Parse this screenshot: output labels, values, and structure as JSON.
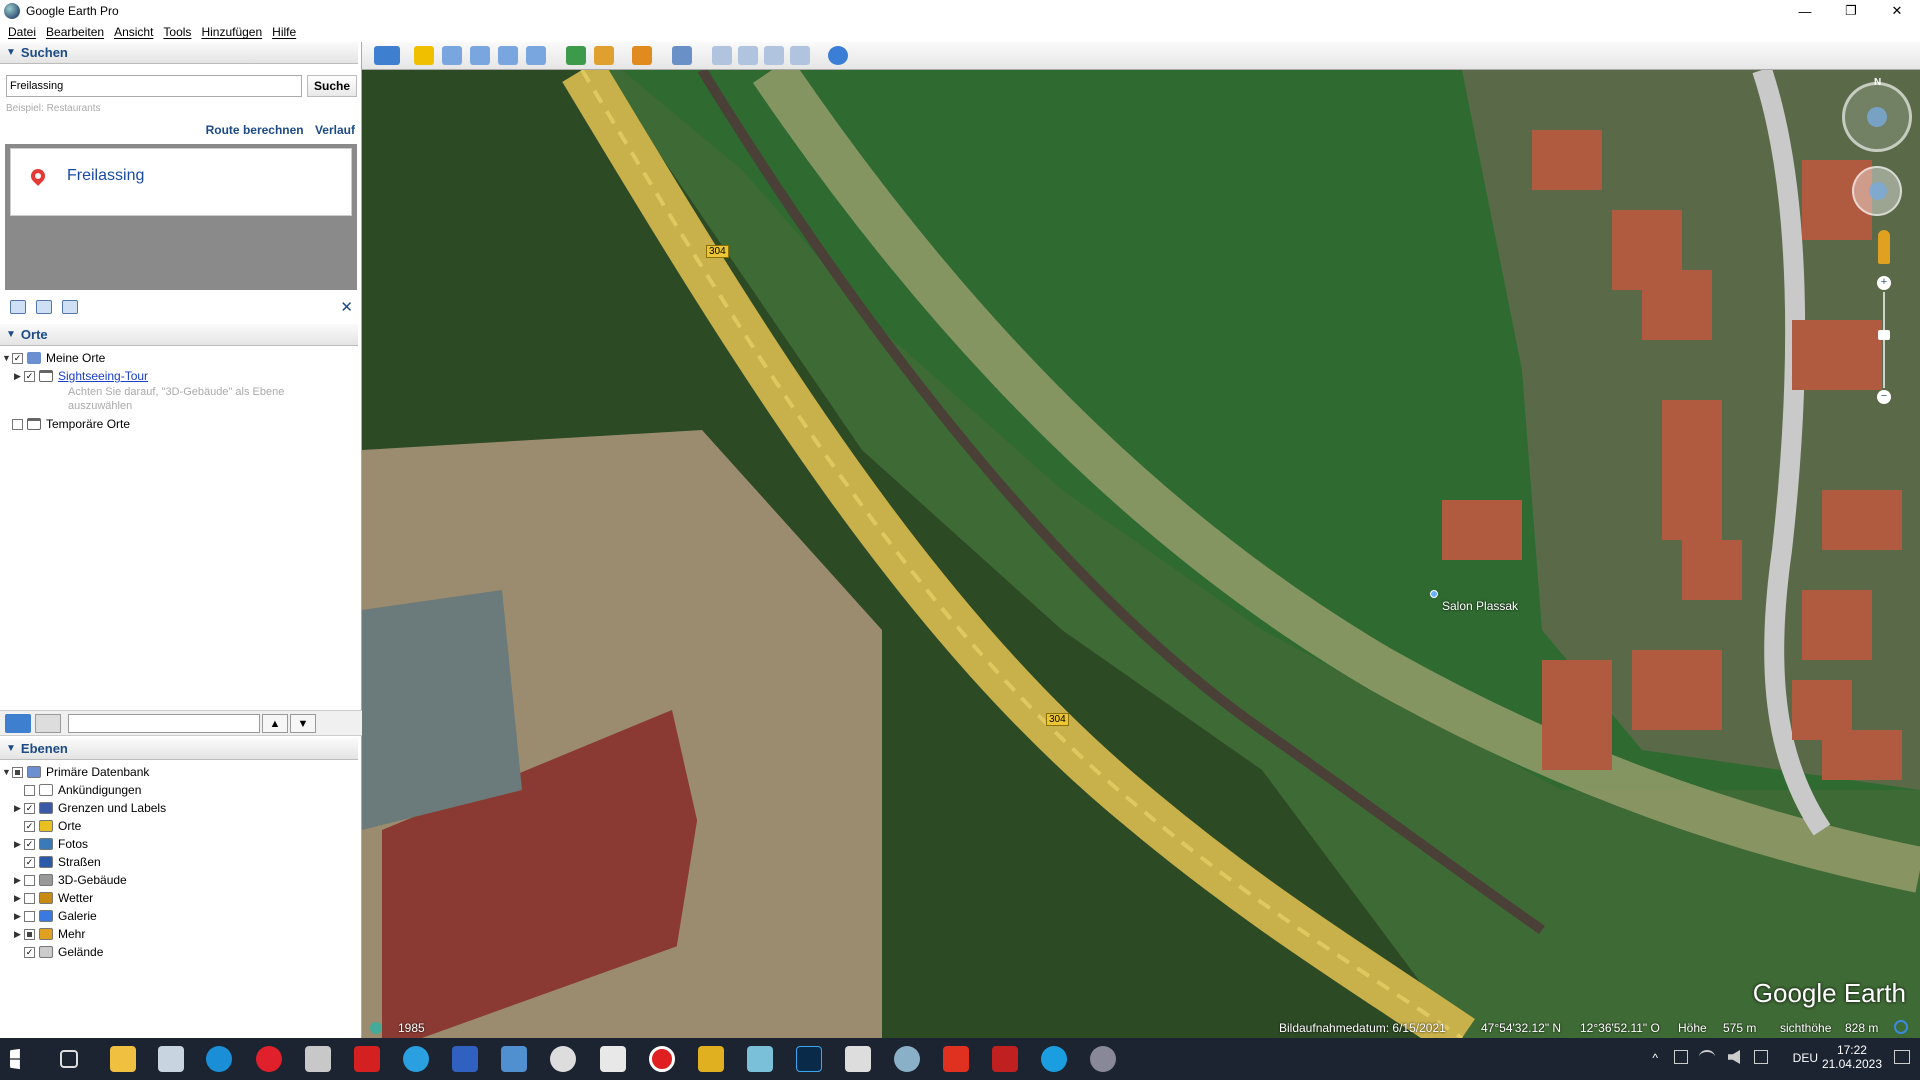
{
  "window": {
    "title": "Google Earth Pro",
    "min": "—",
    "max": "❐",
    "close": "✕"
  },
  "menu": [
    "Datei",
    "Bearbeiten",
    "Ansicht",
    "Tools",
    "Hinzufügen",
    "Hilfe"
  ],
  "search": {
    "header": "Suchen",
    "value": "Freilassing",
    "button": "Suche",
    "hint": "Beispiel: Restaurants",
    "route_link": "Route berechnen",
    "history_link": "Verlauf",
    "result": "Freilassing"
  },
  "places": {
    "header": "Orte",
    "my_places": "Meine Orte",
    "tour": "Sightseeing-Tour",
    "tour_note": "Achten Sie darauf, \"3D-Gebäude\" als Ebene auszuwählen",
    "temp": "Temporäre Orte"
  },
  "layers": {
    "header": "Ebenen",
    "items": [
      {
        "label": "Primäre Datenbank",
        "checked": "partial",
        "expand": true
      },
      {
        "label": "Ankündigungen",
        "checked": false,
        "expand": false
      },
      {
        "label": "Grenzen und Labels",
        "checked": true,
        "expand": true
      },
      {
        "label": "Orte",
        "checked": true,
        "expand": false
      },
      {
        "label": "Fotos",
        "checked": true,
        "expand": true
      },
      {
        "label": "Straßen",
        "checked": true,
        "expand": false
      },
      {
        "label": "3D-Gebäude",
        "checked": false,
        "expand": true
      },
      {
        "label": "Wetter",
        "checked": false,
        "expand": true
      },
      {
        "label": "Galerie",
        "checked": false,
        "expand": true
      },
      {
        "label": "Mehr",
        "checked": "partial",
        "expand": true
      },
      {
        "label": "Gelände",
        "checked": true,
        "expand": false
      }
    ]
  },
  "map": {
    "road_label_1": "304",
    "road_label_2": "304",
    "place_label": "Salon Plassak",
    "brand": "Google Earth",
    "year": "1985",
    "capture_date": "Bildaufnahmedatum: 6/15/2021",
    "lat": "47°54'32.12\" N",
    "lon": "12°36'52.11\" O",
    "elevation_label": "Höhe",
    "elevation": "575 m",
    "eye_label": "sichthöhe",
    "eye": "828 m",
    "compass_n": "N"
  },
  "tray": {
    "lang": "DEU",
    "time": "17:22",
    "date": "21.04.2023"
  }
}
